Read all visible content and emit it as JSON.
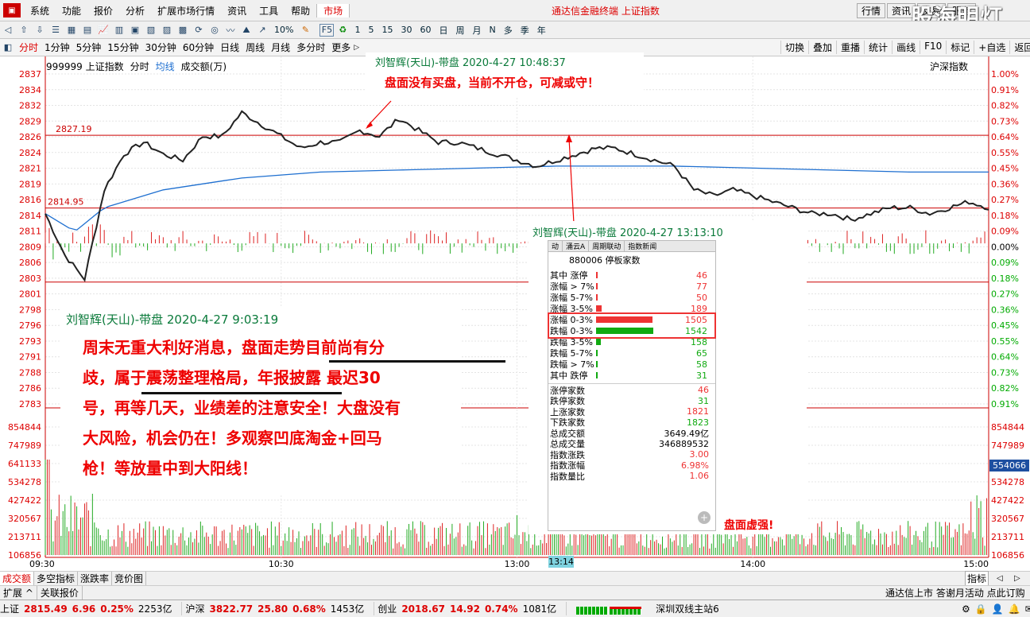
{
  "menubar": {
    "items": [
      "系统",
      "功能",
      "报价",
      "分析",
      "扩展市场行情",
      "资讯",
      "工具",
      "帮助"
    ],
    "active": "市场",
    "title": "通达信金融终端 上证指数",
    "right": [
      "行情",
      "资讯",
      "交易",
      "服务"
    ],
    "watermark": "股海明灯"
  },
  "toolbar": {
    "ten_pct": "10%",
    "nums": [
      "1",
      "5",
      "15",
      "30",
      "60"
    ],
    "periods": [
      "日",
      "周",
      "月",
      "N",
      "多",
      "季",
      "年"
    ]
  },
  "periodbar": {
    "items": [
      "分时",
      "1分钟",
      "5分钟",
      "15分钟",
      "30分钟",
      "60分钟",
      "日线",
      "周线",
      "月线",
      "多分时",
      "更多"
    ],
    "active": "分时",
    "right": [
      "切换",
      "叠加",
      "重播",
      "统计",
      "画线",
      "F10",
      "标记",
      "+自选",
      "返回"
    ]
  },
  "chart_header": {
    "code": "999999 上证指数",
    "mode": "分时",
    "line": "均线",
    "vol": "成交额(万)",
    "right": "沪深指数"
  },
  "chart_data": {
    "type": "line",
    "title": "999999 上证指数",
    "series": [
      {
        "name": "上证指数",
        "points": [
          [
            0,
            2814
          ],
          [
            10,
            2807
          ],
          [
            20,
            2803
          ],
          [
            30,
            2818
          ],
          [
            40,
            2824
          ],
          [
            50,
            2826
          ],
          [
            60,
            2824
          ],
          [
            70,
            2823
          ],
          [
            80,
            2827
          ],
          [
            90,
            2827
          ],
          [
            100,
            2831
          ],
          [
            110,
            2829
          ],
          [
            120,
            2827
          ],
          [
            130,
            2825
          ],
          [
            140,
            2826
          ],
          [
            150,
            2826
          ],
          [
            160,
            2828
          ],
          [
            170,
            2827
          ],
          [
            180,
            2830
          ],
          [
            190,
            2828
          ],
          [
            200,
            2826
          ],
          [
            210,
            2826
          ],
          [
            220,
            2825
          ],
          [
            230,
            2824
          ],
          [
            240,
            2823
          ],
          [
            250,
            2822
          ],
          [
            260,
            2823
          ],
          [
            270,
            2824
          ],
          [
            280,
            2825
          ],
          [
            290,
            2825
          ],
          [
            300,
            2824
          ],
          [
            310,
            2823
          ],
          [
            320,
            2822
          ],
          [
            330,
            2818
          ],
          [
            340,
            2817
          ],
          [
            350,
            2818
          ],
          [
            360,
            2817
          ],
          [
            370,
            2816
          ],
          [
            380,
            2815
          ],
          [
            390,
            2814
          ],
          [
            400,
            2814
          ],
          [
            410,
            2813
          ],
          [
            420,
            2814
          ],
          [
            430,
            2815
          ],
          [
            440,
            2815
          ],
          [
            450,
            2814
          ],
          [
            460,
            2815
          ],
          [
            470,
            2816
          ],
          [
            480,
            2815
          ]
        ]
      },
      {
        "name": "均线",
        "points": [
          [
            0,
            2814
          ],
          [
            15,
            2811
          ],
          [
            30,
            2815
          ],
          [
            60,
            2818
          ],
          [
            100,
            2820
          ],
          [
            140,
            2821
          ],
          [
            200,
            2821.5
          ],
          [
            260,
            2822
          ],
          [
            320,
            2822
          ],
          [
            380,
            2821.5
          ],
          [
            440,
            2821
          ],
          [
            480,
            2821
          ]
        ]
      }
    ],
    "y_price_ticks": [
      "2837",
      "2834",
      "2832",
      "2829",
      "2826",
      "2824",
      "2821",
      "2819",
      "2816",
      "2814",
      "2811",
      "2809",
      "2806",
      "2803",
      "2801",
      "2798",
      "2796",
      "2793",
      "2791",
      "2788",
      "2786",
      "2783"
    ],
    "y_pct_ticks": [
      "1.00%",
      "0.91%",
      "0.82%",
      "0.73%",
      "0.64%",
      "0.55%",
      "0.45%",
      "0.36%",
      "0.27%",
      "0.18%",
      "0.09%",
      "0.00%",
      "0.09%",
      "0.18%",
      "0.27%",
      "0.36%",
      "0.45%",
      "0.55%",
      "0.64%",
      "0.73%",
      "0.82%",
      "0.91%"
    ],
    "vol_ticks": [
      "854844",
      "747989",
      "641133",
      "534278",
      "427422",
      "320567",
      "213711",
      "106856"
    ],
    "vol_current": "554066",
    "x_ticks": [
      "09:30",
      "10:30",
      "13:00",
      "14:00",
      "15:00"
    ],
    "cursor_time": "13:14",
    "ref_lines": [
      {
        "label": "2827.19",
        "value": 2827.19
      },
      {
        "label": "2814.95",
        "value": 2814.95
      },
      {
        "label": "",
        "value": 2802.5
      }
    ],
    "prev_close": 2809
  },
  "popup1": {
    "title": "刘智辉(天山)-带盘 2020-4-27 10:48:37",
    "text": "盘面没有买盘，当前不开仓，可减或守！"
  },
  "popup2": {
    "title": "刘智辉(天山)-带盘 2020-4-27 13:13:10",
    "tabs": [
      "动",
      "涌云A",
      "周期联动",
      "指数新闻"
    ],
    "header": "880006 停板家数",
    "rows": [
      {
        "name": "其中 涨停",
        "value": "46",
        "color": "#e33",
        "frac": 0.01
      },
      {
        "name": "涨幅 > 7%",
        "value": "77",
        "color": "#e33",
        "frac": 0.02
      },
      {
        "name": "涨幅 5-7%",
        "value": "50",
        "color": "#e33",
        "frac": 0.015
      },
      {
        "name": "涨幅 3-5%",
        "value": "189",
        "color": "#e33",
        "frac": 0.07
      },
      {
        "name": "涨幅 0-3%",
        "value": "1505",
        "color": "#e33",
        "frac": 0.75
      },
      {
        "name": "跌幅 0-3%",
        "value": "1542",
        "color": "#1a1",
        "frac": 0.77
      },
      {
        "name": "跌幅 3-5%",
        "value": "158",
        "color": "#1a1",
        "frac": 0.06
      },
      {
        "name": "跌幅 5-7%",
        "value": "65",
        "color": "#1a1",
        "frac": 0.02
      },
      {
        "name": "跌幅 > 7%",
        "value": "58",
        "color": "#1a1",
        "frac": 0.02
      },
      {
        "name": "其中 跌停",
        "value": "31",
        "color": "#1a1",
        "frac": 0.005
      }
    ],
    "stats": [
      {
        "name": "涨停家数",
        "value": "46",
        "color": "#e33"
      },
      {
        "name": "跌停家数",
        "value": "31",
        "color": "#1a1"
      },
      {
        "name": "上涨家数",
        "value": "1821",
        "color": "#e33"
      },
      {
        "name": "下跌家数",
        "value": "1823",
        "color": "#1a1"
      },
      {
        "name": "总成交额",
        "value": "3649.49亿",
        "color": "#000"
      },
      {
        "name": "总成交量",
        "value": "346889532",
        "color": "#000"
      },
      {
        "name": "指数涨跌",
        "value": "3.00",
        "color": "#e33"
      },
      {
        "name": "指数涨幅",
        "value": "6.98%",
        "color": "#e33"
      },
      {
        "name": "指数量比",
        "value": "1.06",
        "color": "#e33"
      }
    ],
    "footer": "盘面虚强!"
  },
  "popup3": {
    "title": "刘智辉(天山)-带盘 2020-4-27 9:03:19",
    "lines": [
      "周末无重大利好消息，盘面走势目前尚有分",
      "歧，属于震荡整理格局，年报披露 最迟30",
      "号，再等几天，业绩差的注意安全！大盘没有",
      "大风险，机会仍在！多观察凹底淘金+回马",
      "枪！等放量中到大阳线！"
    ]
  },
  "bottom_tabs": {
    "items": [
      "成交额",
      "多空指标",
      "涨跌率",
      "竞价图"
    ],
    "right": "指标"
  },
  "bottom_bar2": {
    "items": [
      "扩展 ^",
      "关联报价"
    ],
    "right": "通达信上市 答谢月活动 点此订购"
  },
  "status": {
    "indices": [
      {
        "name": "上证",
        "price": "2815.49",
        "chg": "6.96",
        "pct": "0.25%",
        "amt": "2253亿"
      },
      {
        "name": "沪深",
        "price": "3822.77",
        "chg": "25.80",
        "pct": "0.68%",
        "amt": "1453亿"
      },
      {
        "name": "创业",
        "price": "2018.67",
        "chg": "14.92",
        "pct": "0.74%",
        "amt": "1081亿"
      }
    ],
    "server": "深圳双线主站6"
  }
}
